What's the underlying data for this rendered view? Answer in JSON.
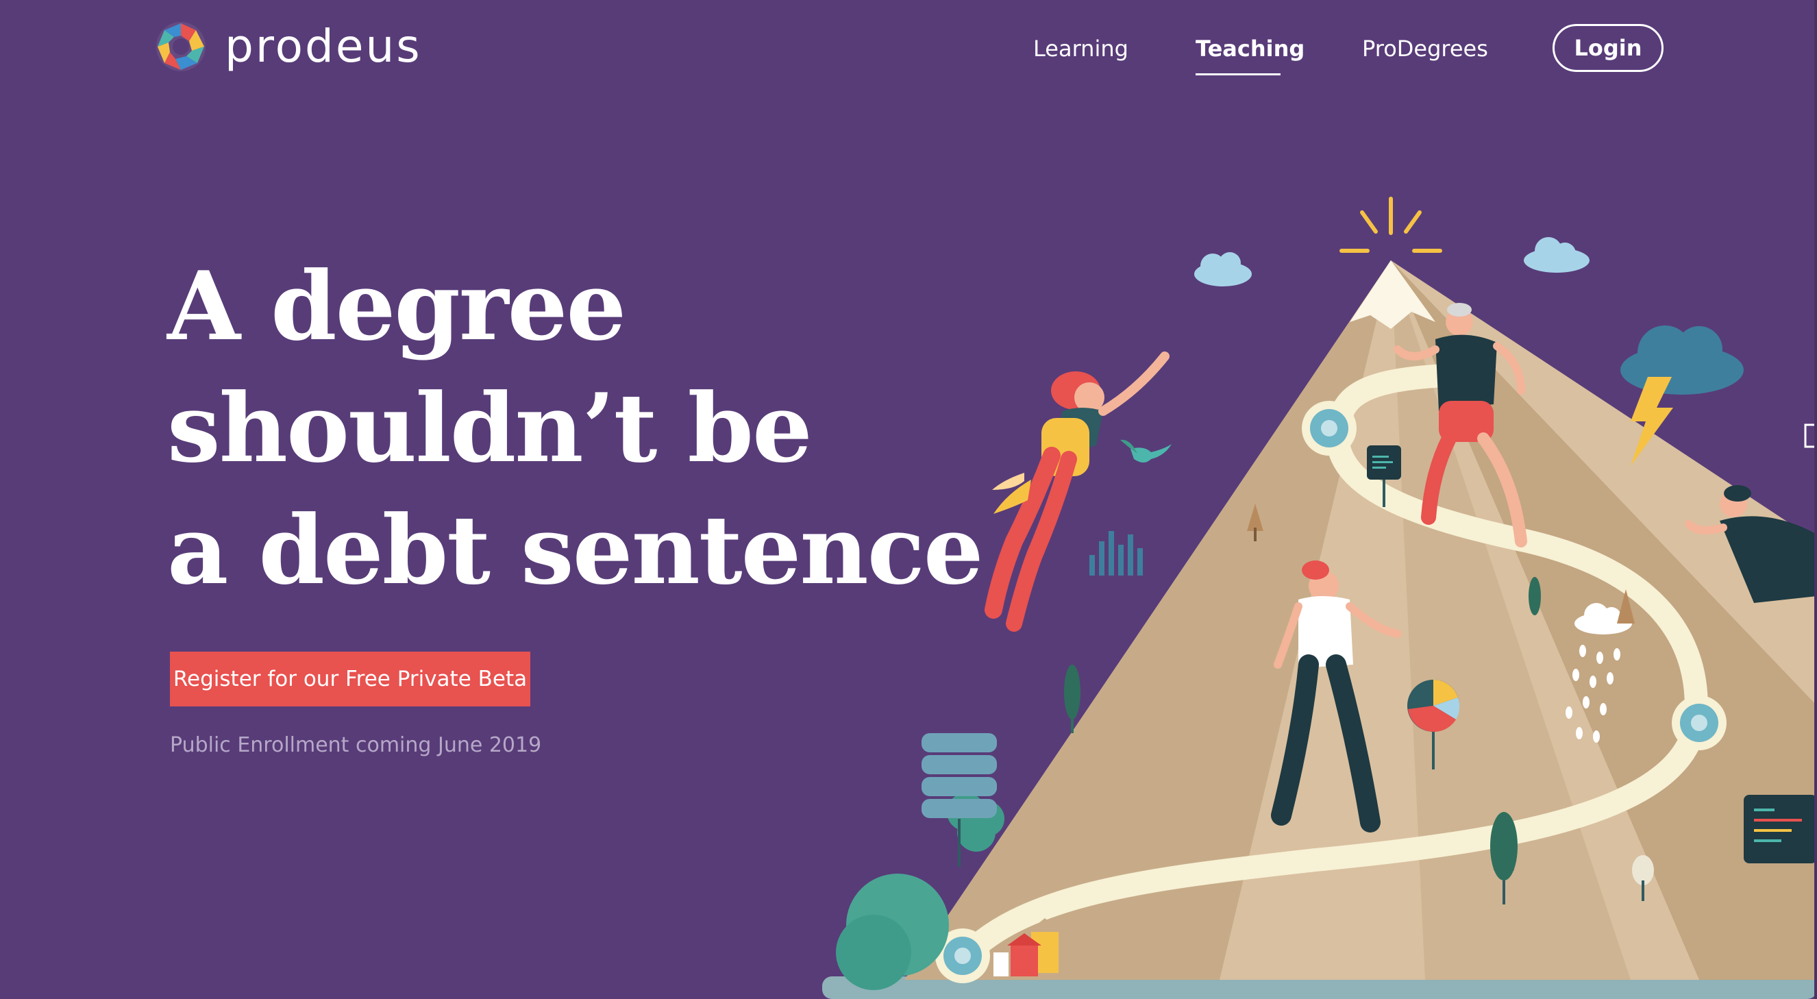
{
  "brand": {
    "name": "prodeus",
    "logo_icon": "prodeus-logo-icon"
  },
  "nav": {
    "items": [
      {
        "label": "Learning",
        "active": false
      },
      {
        "label": "Teaching",
        "active": true
      },
      {
        "label": "ProDegrees",
        "active": false
      }
    ],
    "login_label": "Login"
  },
  "hero": {
    "headline_lines": [
      "A degree",
      "shouldn’t be",
      "a debt sentence"
    ],
    "cta_label": "Register for our Free Private Beta",
    "subnote": "Public Enrollment coming June 2019"
  },
  "colors": {
    "background": "#583c78",
    "accent": "#e8524f",
    "text": "#ffffff",
    "muted_text": "#b6a8c8"
  }
}
